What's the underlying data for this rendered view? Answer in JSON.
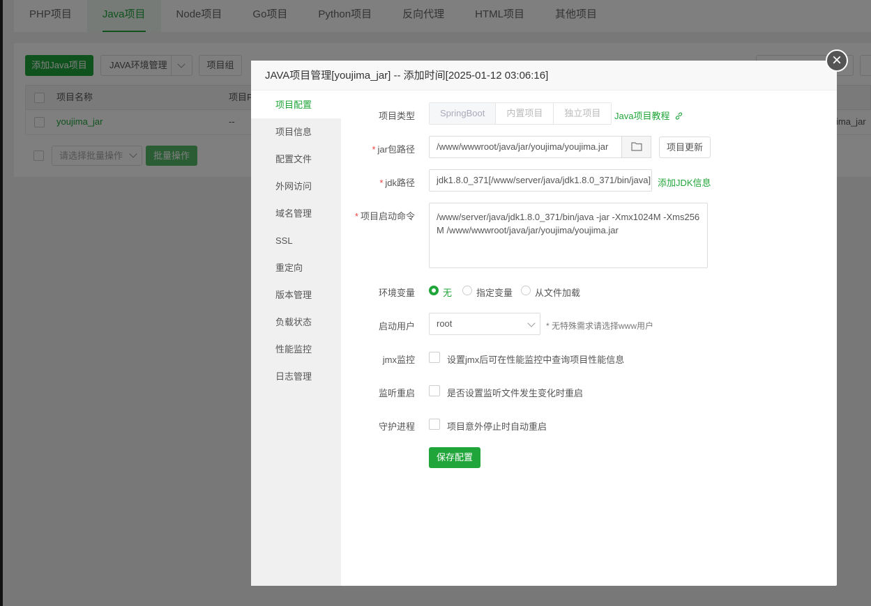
{
  "topnav": {
    "tabs": [
      "PHP项目",
      "Java项目",
      "Node项目",
      "Go项目",
      "Python项目",
      "反向代理",
      "HTML项目",
      "其他项目"
    ]
  },
  "toolbar": {
    "add_label": "添加Java项目",
    "env_label": "JAVA环境管理",
    "group_label": "项目组"
  },
  "table": {
    "col_name": "项目名称",
    "col_second": "项目P",
    "row_name": "youjima_jar",
    "row_second": "--",
    "row_right": "ima_jar"
  },
  "batch": {
    "placeholder": "请选择批量操作",
    "button": "批量操作"
  },
  "modal": {
    "title": "JAVA项目管理[youjima_jar] -- 添加时间[2025-01-12 03:06:16]",
    "close": "×",
    "sidebar": [
      "项目配置",
      "项目信息",
      "配置文件",
      "外网访问",
      "域名管理",
      "SSL",
      "重定向",
      "版本管理",
      "负载状态",
      "性能监控",
      "日志管理"
    ],
    "form": {
      "type_label": "项目类型",
      "type_options": [
        "SpringBoot",
        "内置项目",
        "独立项目"
      ],
      "tutorial_link": "Java项目教程",
      "jar_label": "jar包路径",
      "jar_value": "/www/wwwroot/java/jar/youjima/youjima.jar",
      "update_button": "项目更新",
      "jdk_label": "jdk路径",
      "jdk_value": "jdk1.8.0_371[/www/server/java/jdk1.8.0_371/bin/java]",
      "add_jdk_link": "添加JDK信息",
      "cmd_label": "项目启动命令",
      "cmd_value": "/www/server/java/jdk1.8.0_371/bin/java -jar  -Xmx1024M -Xms256M /www/wwwroot/java/jar/youjima/youjima.jar",
      "env_label": "环境变量",
      "env_options": [
        "无",
        "指定变量",
        "从文件加载"
      ],
      "user_label": "启动用户",
      "user_value": "root",
      "user_hint": "* 无特殊需求请选择www用户",
      "jmx_label": "jmx监控",
      "jmx_text": "设置jmx后可在性能监控中查询项目性能信息",
      "watch_label": "监听重启",
      "watch_text": "是否设置监听文件发生变化时重启",
      "daemon_label": "守护进程",
      "daemon_text": "项目意外停止时自动重启",
      "save_button": "保存配置"
    }
  },
  "colors": {
    "accent": "#20a53a",
    "required": "#f04040"
  }
}
